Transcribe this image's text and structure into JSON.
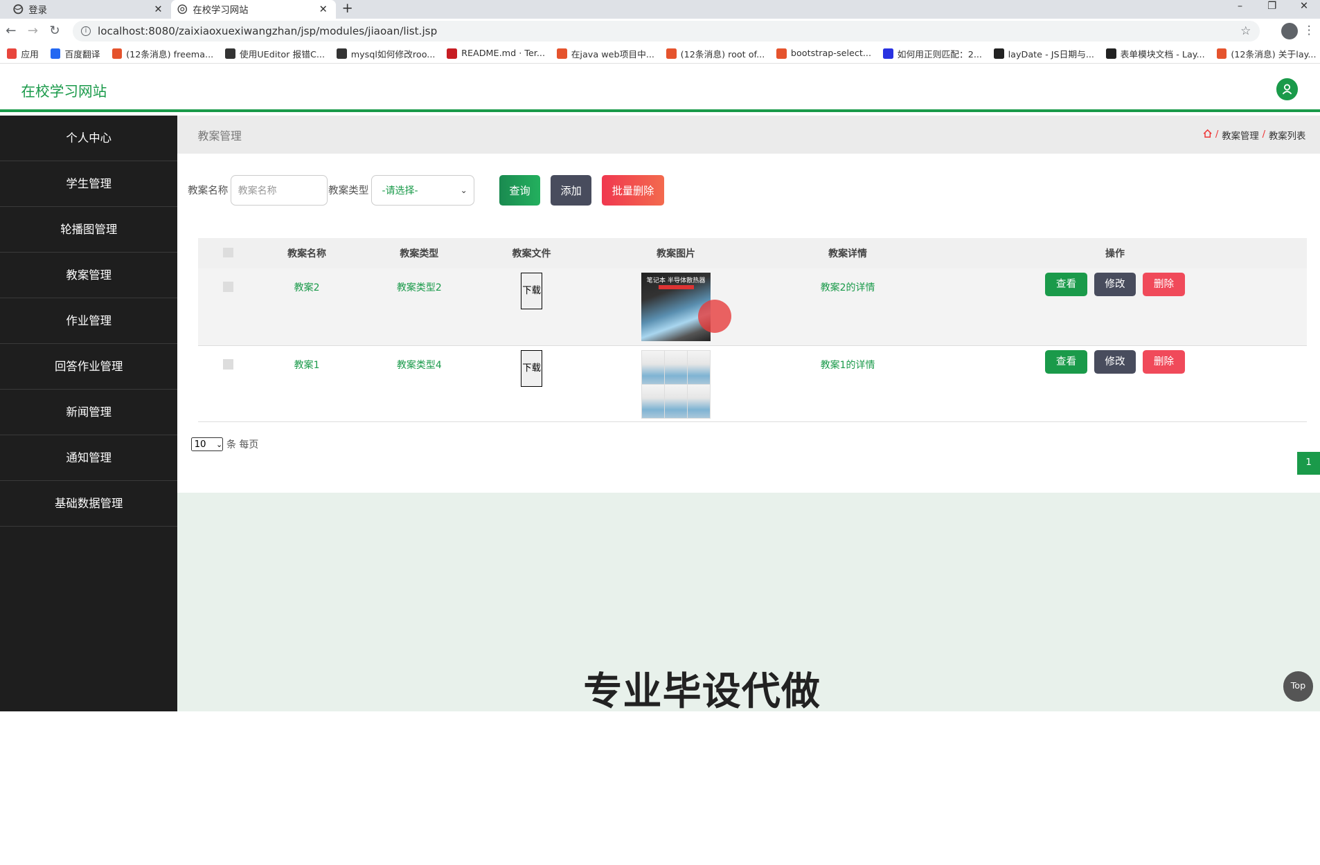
{
  "browser": {
    "tabs": [
      {
        "label": "登录",
        "icon": "globe-icon"
      },
      {
        "label": "在校学习网站",
        "icon": "site-icon"
      }
    ],
    "url": "localhost:8080/zaixiaoxuexiwangzhan/jsp/modules/jiaoan/list.jsp",
    "bookmarks": [
      {
        "label": "应用",
        "color": "#e8453c"
      },
      {
        "label": "百度翻译",
        "color": "#2468f2"
      },
      {
        "label": "(12条消息) freema...",
        "color": "#e5532d"
      },
      {
        "label": "使用UEditor 报错C...",
        "color": "#333333"
      },
      {
        "label": "mysql如何修改roo...",
        "color": "#333333"
      },
      {
        "label": "README.md · Ter...",
        "color": "#c71d23"
      },
      {
        "label": "在java web项目中...",
        "color": "#e5532d"
      },
      {
        "label": "(12条消息) root of...",
        "color": "#e5532d"
      },
      {
        "label": "bootstrap-select...",
        "color": "#e5532d"
      },
      {
        "label": "如何用正则匹配：2...",
        "color": "#2932e1"
      },
      {
        "label": "layDate - JS日期与...",
        "color": "#222222"
      },
      {
        "label": "表单模块文档 - Lay...",
        "color": "#222222"
      },
      {
        "label": "(12条消息) 关于lay...",
        "color": "#e5532d"
      }
    ]
  },
  "site": {
    "title": "在校学习网站",
    "accent": "#1a9a4a"
  },
  "sidebar": {
    "items": [
      {
        "label": "个人中心"
      },
      {
        "label": "学生管理"
      },
      {
        "label": "轮播图管理"
      },
      {
        "label": "教案管理"
      },
      {
        "label": "作业管理"
      },
      {
        "label": "回答作业管理"
      },
      {
        "label": "新闻管理"
      },
      {
        "label": "通知管理"
      },
      {
        "label": "基础数据管理"
      }
    ]
  },
  "page": {
    "title": "教案管理",
    "breadcrumb": [
      "教案管理",
      "教案列表"
    ]
  },
  "search": {
    "name_label": "教案名称",
    "name_placeholder": "教案名称",
    "type_label": "教案类型",
    "type_selected": "-请选择-",
    "query_label": "查询",
    "add_label": "添加",
    "batch_delete_label": "批量删除"
  },
  "table": {
    "headers": [
      "教案名称",
      "教案类型",
      "教案文件",
      "教案图片",
      "教案详情",
      "操作"
    ],
    "rows": [
      {
        "name": "教案2",
        "type": "教案类型2",
        "file_label": "下载",
        "image_caption": "笔记本 半导体散热器",
        "detail": "教案2的详情"
      },
      {
        "name": "教案1",
        "type": "教案类型4",
        "file_label": "下载",
        "image_caption": "",
        "detail": "教案1的详情"
      }
    ],
    "actions": {
      "view": "查看",
      "edit": "修改",
      "delete": "删除"
    }
  },
  "pagination": {
    "page_size": "10",
    "page_size_suffix": "条 每页",
    "current_page": "1"
  },
  "watermark": "专业毕设代做",
  "top_button": "Top"
}
